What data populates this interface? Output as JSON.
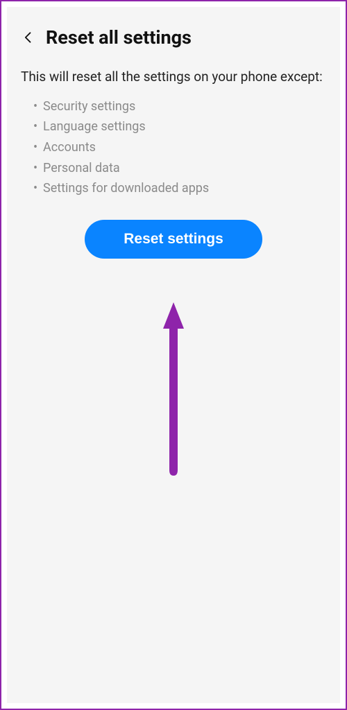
{
  "header": {
    "title": "Reset all settings"
  },
  "description": "This will reset all the settings on your phone except:",
  "exceptions": {
    "0": "Security settings",
    "1": "Language settings",
    "2": "Accounts",
    "3": "Personal data",
    "4": "Settings for downloaded apps"
  },
  "actions": {
    "reset_label": "Reset settings"
  },
  "colors": {
    "accent": "#0a84ff",
    "annotation": "#8e24aa"
  }
}
